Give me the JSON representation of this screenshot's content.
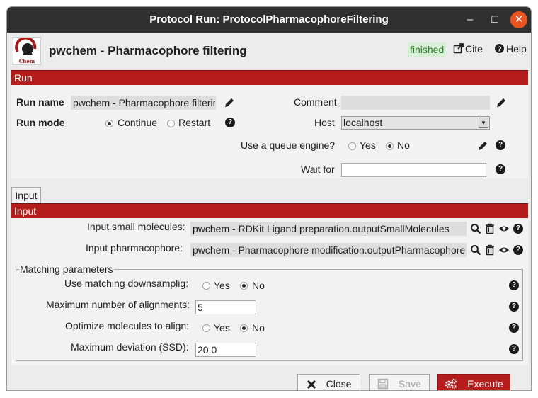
{
  "window": {
    "title": "Protocol Run: ProtocolPharmacophoreFiltering",
    "min_icon": "minimize-icon",
    "max_icon": "maximize-icon",
    "close_icon": "close-icon"
  },
  "header": {
    "logo_text": "Chem",
    "protocol_name": "pwchem - Pharmacophore filtering",
    "status": "finished",
    "cite": "Cite",
    "help": "Help"
  },
  "run": {
    "section": "Run",
    "run_name_label": "Run name",
    "run_name_value": "pwchem - Pharmacophore filtering",
    "comment_label": "Comment",
    "comment_value": "",
    "run_mode_label": "Run mode",
    "run_mode_options": [
      "Continue",
      "Restart"
    ],
    "run_mode_selected": "Continue",
    "host_label": "Host",
    "host_value": "localhost",
    "queue_label": "Use a queue engine?",
    "queue_options": [
      "Yes",
      "No"
    ],
    "queue_selected": "No",
    "wait_label": "Wait for",
    "wait_value": ""
  },
  "tabs": [
    {
      "label": "Input"
    }
  ],
  "input": {
    "section": "Input",
    "small_molecules_label": "Input small molecules:",
    "small_molecules_value": "pwchem - RDKit Ligand preparation.outputSmallMolecules",
    "pharmacophore_label": "Input pharmacophore:",
    "pharmacophore_value": "pwchem - Pharmacophore modification.outputPharmacophore",
    "matching": {
      "legend": "Matching parameters",
      "downsampling_label": "Use matching downsamplig:",
      "downsampling_options": [
        "Yes",
        "No"
      ],
      "downsampling_selected": "No",
      "max_alignments_label": "Maximum number of alignments:",
      "max_alignments_value": "5",
      "optimize_label": "Optimize molecules to align:",
      "optimize_options": [
        "Yes",
        "No"
      ],
      "optimize_selected": "No",
      "max_deviation_label": "Maximum deviation (SSD):",
      "max_deviation_value": "20.0"
    }
  },
  "buttons": {
    "close": "Close",
    "save": "Save",
    "execute": "Execute"
  },
  "colors": {
    "accent": "#b51d1d",
    "status_bg": "#d6efd6",
    "status_fg": "#2b7d2b",
    "titlebar": "#2f2f2f",
    "close_btn": "#e95420"
  }
}
